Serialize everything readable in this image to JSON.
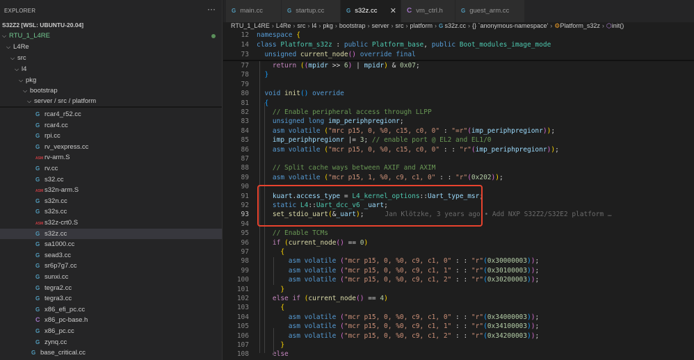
{
  "sidebar": {
    "title": "EXPLORER",
    "more": "···",
    "workspace": "S32Z2 [WSL: UBUNTU-20.04]",
    "folders": [
      {
        "label": "RTU_1_L4RE"
      },
      {
        "label": "L4Re"
      },
      {
        "label": "src"
      },
      {
        "label": "l4"
      },
      {
        "label": "pkg"
      },
      {
        "label": "bootstrap"
      },
      {
        "label": "server / src / platform"
      }
    ],
    "files": [
      {
        "label": "rcar4_r52.cc",
        "type": "cpp"
      },
      {
        "label": "rcar4.cc",
        "type": "cpp"
      },
      {
        "label": "rpi.cc",
        "type": "cpp"
      },
      {
        "label": "rv_vexpress.cc",
        "type": "cpp"
      },
      {
        "label": "rv-arm.S",
        "type": "asm"
      },
      {
        "label": "rv.cc",
        "type": "cpp"
      },
      {
        "label": "s32.cc",
        "type": "cpp"
      },
      {
        "label": "s32n-arm.S",
        "type": "asm"
      },
      {
        "label": "s32n.cc",
        "type": "cpp"
      },
      {
        "label": "s32s.cc",
        "type": "cpp"
      },
      {
        "label": "s32z-crt0.S",
        "type": "asm"
      },
      {
        "label": "s32z.cc",
        "type": "cpp",
        "selected": true
      },
      {
        "label": "sa1000.cc",
        "type": "cpp"
      },
      {
        "label": "sead3.cc",
        "type": "cpp"
      },
      {
        "label": "sr6p7g7.cc",
        "type": "cpp"
      },
      {
        "label": "sunxi.cc",
        "type": "cpp"
      },
      {
        "label": "tegra2.cc",
        "type": "cpp"
      },
      {
        "label": "tegra3.cc",
        "type": "cpp"
      },
      {
        "label": "x86_efi_pc.cc",
        "type": "cpp"
      },
      {
        "label": "x86_pc-base.h",
        "type": "h"
      },
      {
        "label": "x86_pc.cc",
        "type": "cpp"
      },
      {
        "label": "zynq.cc",
        "type": "cpp"
      },
      {
        "label": "base_critical.cc",
        "type": "cpp",
        "outer": true
      }
    ],
    "asm_icon": "ASM"
  },
  "tabs": [
    {
      "label": "main.cc",
      "icon": "cpp"
    },
    {
      "label": "startup.cc",
      "icon": "cpp"
    },
    {
      "label": "s32z.cc",
      "icon": "cpp",
      "active": true
    },
    {
      "label": "vm_ctrl.h",
      "icon": "h"
    },
    {
      "label": "guest_arm.cc",
      "icon": "cpp"
    }
  ],
  "breadcrumb": [
    "RTU_1_L4RE",
    "L4Re",
    "src",
    "l4",
    "pkg",
    "bootstrap",
    "server",
    "src",
    "platform",
    "s32z.cc",
    "`anonymous-namespace'",
    "Platform_s32z",
    "init()"
  ],
  "blame": "Jan Klötzke, 3 years ago • Add NXP S32Z2/S32E2 platform …",
  "sticky": [
    {
      "n": "12",
      "t": [
        [
          "namespace ",
          "kw"
        ],
        [
          "{",
          "b1"
        ]
      ]
    },
    {
      "n": "14",
      "t": [
        [
          "class ",
          "kw"
        ],
        [
          "Platform_s32z",
          "ty"
        ],
        [
          " : ",
          "p"
        ],
        [
          "public ",
          "kw"
        ],
        [
          "Platform_base",
          "ty"
        ],
        [
          ", ",
          "p"
        ],
        [
          "public ",
          "kw"
        ],
        [
          "Boot_modules_image_mode",
          "ty"
        ]
      ]
    },
    {
      "n": "73",
      "t": [
        [
          "  unsigned ",
          "kw"
        ],
        [
          "current_node",
          "fn"
        ],
        [
          "()",
          "b2"
        ],
        [
          " override final",
          "kw"
        ]
      ]
    }
  ],
  "lines": [
    {
      "n": "77",
      "t": [
        [
          "    return ",
          "ctl"
        ],
        [
          "(",
          "b1"
        ],
        [
          "(",
          "b2"
        ],
        [
          "mpidr ",
          "var"
        ],
        [
          ">> ",
          "p"
        ],
        [
          "6",
          "num2"
        ],
        [
          ")",
          "b2"
        ],
        [
          " | ",
          "p"
        ],
        [
          "mpidr",
          "var"
        ],
        [
          ")",
          "b1"
        ],
        [
          " & ",
          "p"
        ],
        [
          "0x07",
          "num2"
        ],
        [
          ";",
          "p"
        ]
      ]
    },
    {
      "n": "78",
      "t": [
        [
          "  }",
          "b3"
        ]
      ]
    },
    {
      "n": "79",
      "t": []
    },
    {
      "n": "80",
      "t": [
        [
          "  void ",
          "kw"
        ],
        [
          "init",
          "fn"
        ],
        [
          "() ",
          "b3"
        ],
        [
          "override",
          "kw"
        ]
      ]
    },
    {
      "n": "81",
      "t": [
        [
          "  {",
          "b3"
        ]
      ]
    },
    {
      "n": "82",
      "t": [
        [
          "    // Enable peripheral access through LLPP",
          "cm"
        ]
      ]
    },
    {
      "n": "83",
      "t": [
        [
          "    unsigned long ",
          "kw"
        ],
        [
          "imp_periphpregionr",
          "var"
        ],
        [
          ";",
          "p"
        ]
      ]
    },
    {
      "n": "84",
      "t": [
        [
          "    asm volatile ",
          "kw"
        ],
        [
          "(",
          "b1"
        ],
        [
          "\"mrc p15, 0, %0, c15, c0, 0\"",
          "str"
        ],
        [
          " : ",
          "p"
        ],
        [
          "\"=r\"",
          "str"
        ],
        [
          "(",
          "b2"
        ],
        [
          "imp_periphpregionr",
          "var"
        ],
        [
          ")",
          "b2"
        ],
        [
          ")",
          "b1"
        ],
        [
          ";",
          "p"
        ]
      ]
    },
    {
      "n": "85",
      "t": [
        [
          "    imp_periphpregionr ",
          "var"
        ],
        [
          "|= ",
          "p"
        ],
        [
          "3",
          "num2"
        ],
        [
          "; ",
          "p"
        ],
        [
          "// enable port @ EL2 and EL1/0",
          "cm"
        ]
      ]
    },
    {
      "n": "86",
      "t": [
        [
          "    asm volatile ",
          "kw"
        ],
        [
          "(",
          "b1"
        ],
        [
          "\"mcr p15, 0, %0, c15, c0, 0\"",
          "str"
        ],
        [
          " : : ",
          "p"
        ],
        [
          "\"r\"",
          "str"
        ],
        [
          "(",
          "b2"
        ],
        [
          "imp_periphpregionr",
          "var"
        ],
        [
          ")",
          "b2"
        ],
        [
          ")",
          "b1"
        ],
        [
          ";",
          "p"
        ]
      ]
    },
    {
      "n": "87",
      "t": []
    },
    {
      "n": "88",
      "t": [
        [
          "    // Split cache ways between AXIF and AXIM",
          "cm"
        ]
      ]
    },
    {
      "n": "89",
      "t": [
        [
          "    asm volatile ",
          "kw"
        ],
        [
          "(",
          "b1"
        ],
        [
          "\"mcr p15, 1, %0, c9, c1, 0\"",
          "str"
        ],
        [
          " : : ",
          "p"
        ],
        [
          "\"r\"",
          "str"
        ],
        [
          "(",
          "b2"
        ],
        [
          "0x202",
          "num2"
        ],
        [
          ")",
          "b2"
        ],
        [
          ")",
          "b1"
        ],
        [
          ";",
          "p"
        ]
      ]
    },
    {
      "n": "90",
      "t": []
    },
    {
      "n": "91",
      "t": [
        [
          "    kuart",
          "var"
        ],
        [
          ".",
          "p"
        ],
        [
          "access_type",
          "var"
        ],
        [
          " = ",
          "p"
        ],
        [
          "L4_kernel_options",
          "ty"
        ],
        [
          "::",
          "p"
        ],
        [
          "Uart_type_msr",
          "var"
        ],
        [
          ";",
          "p"
        ]
      ]
    },
    {
      "n": "92",
      "t": [
        [
          "    static ",
          "kw"
        ],
        [
          "L4",
          "ty"
        ],
        [
          "::",
          "p"
        ],
        [
          "Uart_dcc_v6",
          "ty"
        ],
        [
          " _uart",
          "var"
        ],
        [
          ";",
          "p"
        ]
      ]
    },
    {
      "n": "93",
      "cur": true,
      "blame": true,
      "t": [
        [
          "    set_stdio_uart",
          "fn"
        ],
        [
          "(",
          "b1"
        ],
        [
          "&",
          "p"
        ],
        [
          "_uart",
          "var"
        ],
        [
          ")",
          "b1"
        ],
        [
          ";",
          "p"
        ]
      ]
    },
    {
      "n": "94",
      "t": []
    },
    {
      "n": "95",
      "t": [
        [
          "    // Enable TCMs",
          "cm"
        ]
      ]
    },
    {
      "n": "96",
      "t": [
        [
          "    if ",
          "ctl"
        ],
        [
          "(",
          "b1"
        ],
        [
          "current_node",
          "fn"
        ],
        [
          "()",
          "b2"
        ],
        [
          " == ",
          "p"
        ],
        [
          "0",
          "num2"
        ],
        [
          ")",
          "b1"
        ]
      ]
    },
    {
      "n": "97",
      "t": [
        [
          "      {",
          "b1"
        ]
      ]
    },
    {
      "n": "98",
      "t": [
        [
          "        asm volatile ",
          "kw"
        ],
        [
          "(",
          "b2"
        ],
        [
          "\"mcr p15, 0, %0, c9, c1, 0\"",
          "str"
        ],
        [
          " : : ",
          "p"
        ],
        [
          "\"r\"",
          "str"
        ],
        [
          "(",
          "b3"
        ],
        [
          "0x30000003",
          "num2"
        ],
        [
          ")",
          "b3"
        ],
        [
          ")",
          "b2"
        ],
        [
          ";",
          "p"
        ]
      ]
    },
    {
      "n": "99",
      "t": [
        [
          "        asm volatile ",
          "kw"
        ],
        [
          "(",
          "b2"
        ],
        [
          "\"mcr p15, 0, %0, c9, c1, 1\"",
          "str"
        ],
        [
          " : : ",
          "p"
        ],
        [
          "\"r\"",
          "str"
        ],
        [
          "(",
          "b3"
        ],
        [
          "0x30100003",
          "num2"
        ],
        [
          ")",
          "b3"
        ],
        [
          ")",
          "b2"
        ],
        [
          ";",
          "p"
        ]
      ]
    },
    {
      "n": "100",
      "t": [
        [
          "        asm volatile ",
          "kw"
        ],
        [
          "(",
          "b2"
        ],
        [
          "\"mcr p15, 0, %0, c9, c1, 2\"",
          "str"
        ],
        [
          " : : ",
          "p"
        ],
        [
          "\"r\"",
          "str"
        ],
        [
          "(",
          "b3"
        ],
        [
          "0x30200003",
          "num2"
        ],
        [
          ")",
          "b3"
        ],
        [
          ")",
          "b2"
        ],
        [
          ";",
          "p"
        ]
      ]
    },
    {
      "n": "101",
      "t": [
        [
          "      }",
          "b1"
        ]
      ]
    },
    {
      "n": "102",
      "t": [
        [
          "    else if ",
          "ctl"
        ],
        [
          "(",
          "b1"
        ],
        [
          "current_node",
          "fn"
        ],
        [
          "()",
          "b2"
        ],
        [
          " == ",
          "p"
        ],
        [
          "4",
          "num2"
        ],
        [
          ")",
          "b1"
        ]
      ]
    },
    {
      "n": "103",
      "t": [
        [
          "      {",
          "b1"
        ]
      ]
    },
    {
      "n": "104",
      "t": [
        [
          "        asm volatile ",
          "kw"
        ],
        [
          "(",
          "b2"
        ],
        [
          "\"mcr p15, 0, %0, c9, c1, 0\"",
          "str"
        ],
        [
          " : : ",
          "p"
        ],
        [
          "\"r\"",
          "str"
        ],
        [
          "(",
          "b3"
        ],
        [
          "0x34000003",
          "num2"
        ],
        [
          ")",
          "b3"
        ],
        [
          ")",
          "b2"
        ],
        [
          ";",
          "p"
        ]
      ]
    },
    {
      "n": "105",
      "t": [
        [
          "        asm volatile ",
          "kw"
        ],
        [
          "(",
          "b2"
        ],
        [
          "\"mcr p15, 0, %0, c9, c1, 1\"",
          "str"
        ],
        [
          " : : ",
          "p"
        ],
        [
          "\"r\"",
          "str"
        ],
        [
          "(",
          "b3"
        ],
        [
          "0x34100003",
          "num2"
        ],
        [
          ")",
          "b3"
        ],
        [
          ")",
          "b2"
        ],
        [
          ";",
          "p"
        ]
      ]
    },
    {
      "n": "106",
      "t": [
        [
          "        asm volatile ",
          "kw"
        ],
        [
          "(",
          "b2"
        ],
        [
          "\"mcr p15, 0, %0, c9, c1, 2\"",
          "str"
        ],
        [
          " : : ",
          "p"
        ],
        [
          "\"r\"",
          "str"
        ],
        [
          "(",
          "b3"
        ],
        [
          "0x34200003",
          "num2"
        ],
        [
          ")",
          "b3"
        ],
        [
          ")",
          "b2"
        ],
        [
          ";",
          "p"
        ]
      ]
    },
    {
      "n": "107",
      "t": [
        [
          "      }",
          "b1"
        ]
      ]
    },
    {
      "n": "108",
      "t": [
        [
          "    else",
          "ctl"
        ]
      ]
    }
  ]
}
